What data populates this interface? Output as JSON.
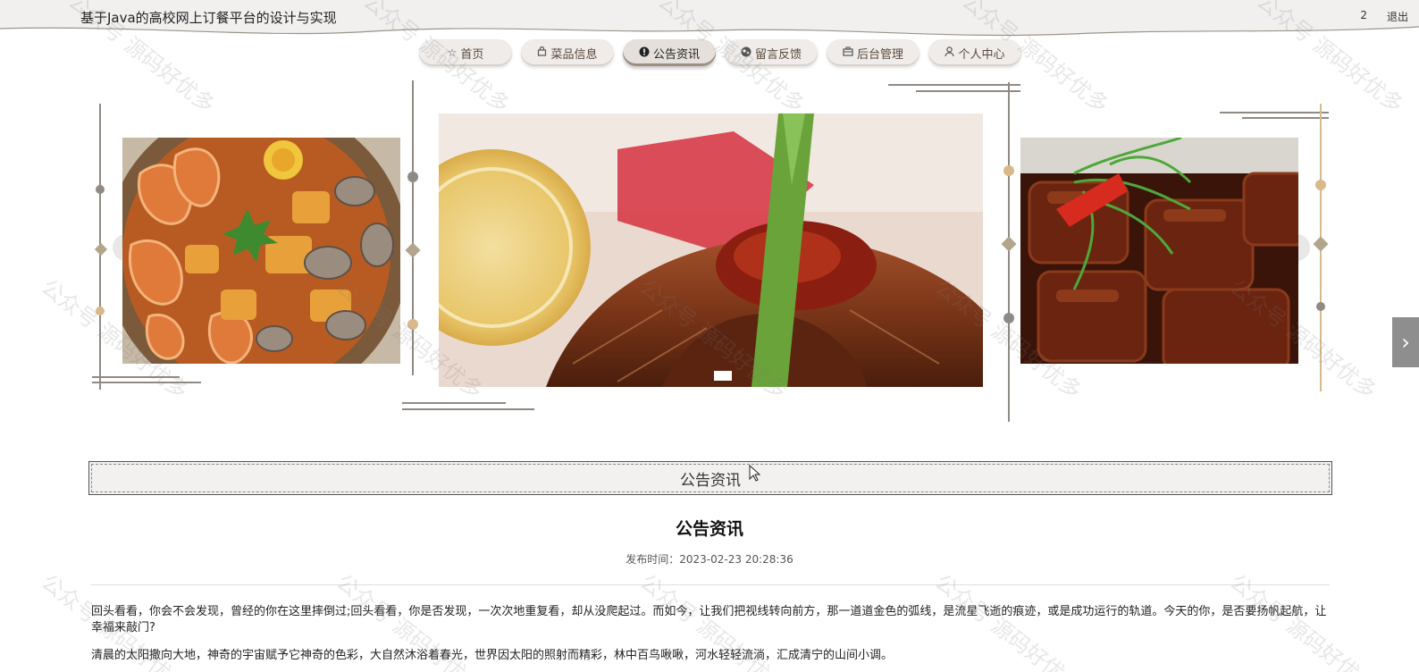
{
  "header": {
    "site_title": "基于Java的高校网上订餐平台的设计与实现",
    "user_label": "2",
    "logout_label": "退出"
  },
  "nav": {
    "items": [
      {
        "label": "首页",
        "icon": "star-icon"
      },
      {
        "label": "菜品信息",
        "icon": "bag-icon"
      },
      {
        "label": "公告资讯",
        "icon": "info-icon"
      },
      {
        "label": "留言反馈",
        "icon": "chat-icon"
      },
      {
        "label": "后台管理",
        "icon": "briefcase-icon"
      },
      {
        "label": "个人中心",
        "icon": "user-icon"
      }
    ],
    "active_index": 2
  },
  "carousel": {
    "slides": [
      "seafood-platter-image",
      "grilled-pork-asparagus-image",
      "braised-pork-image"
    ],
    "active_slide": 1,
    "next_icon": "chevron-right-icon"
  },
  "section": {
    "heading": "公告资讯"
  },
  "article": {
    "title": "公告资讯",
    "time": "发布时间：2023-02-23 20:28:36",
    "paragraphs": [
      "回头看看，你会不会发现，曾经的你在这里摔倒过;回头看看，你是否发现，一次次地重复看，却从没爬起过。而如今，让我们把视线转向前方，那一道道金色的弧线，是流星飞逝的痕迹，或是成功运行的轨道。今天的你，是否要扬帆起航，让幸福来敲门?",
      "清晨的太阳撒向大地，神奇的宇宙赋予它神奇的色彩，大自然沐浴着春光，世界因太阳的照射而精彩，林中百鸟啾啾，河水轻轻流淌，汇成清宁的山间小调。"
    ]
  },
  "watermark": "公众号 源码好优多",
  "colors": {
    "accent_gold": "#d9b98a",
    "dark_line": "#7a6e62",
    "nav_bg": "#efecea"
  }
}
